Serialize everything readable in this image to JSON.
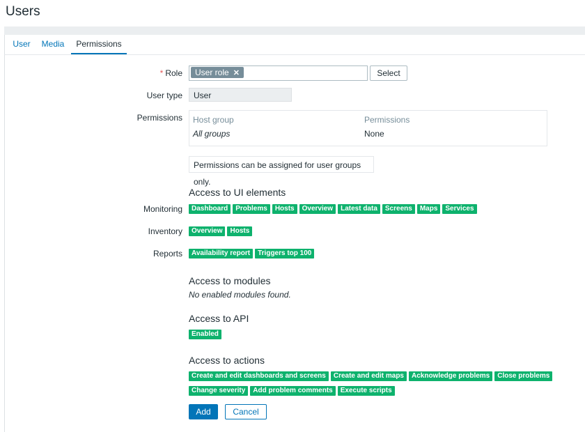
{
  "page_title": "Users",
  "tabs": [
    {
      "label": "User"
    },
    {
      "label": "Media"
    },
    {
      "label": "Permissions"
    }
  ],
  "form": {
    "role": {
      "label": "Role",
      "required_mark": "*",
      "value": "User role",
      "select_label": "Select"
    },
    "user_type": {
      "label": "User type",
      "value": "User"
    },
    "permissions": {
      "label": "Permissions",
      "headers": [
        "Host group",
        "Permissions"
      ],
      "rows": [
        [
          "All groups",
          "None"
        ]
      ],
      "note": "Permissions can be assigned for user groups only."
    }
  },
  "ui_access": {
    "title": "Access to UI elements",
    "groups": [
      {
        "label": "Monitoring",
        "items": [
          "Dashboard",
          "Problems",
          "Hosts",
          "Overview",
          "Latest data",
          "Screens",
          "Maps",
          "Services"
        ]
      },
      {
        "label": "Inventory",
        "items": [
          "Overview",
          "Hosts"
        ]
      },
      {
        "label": "Reports",
        "items": [
          "Availability report",
          "Triggers top 100"
        ]
      }
    ]
  },
  "modules": {
    "title": "Access to modules",
    "empty": "No enabled modules found."
  },
  "api": {
    "title": "Access to API",
    "status": "Enabled"
  },
  "actions": {
    "title": "Access to actions",
    "row1": [
      "Create and edit dashboards and screens",
      "Create and edit maps",
      "Acknowledge problems",
      "Close problems"
    ],
    "row2": [
      "Change severity",
      "Add problem comments",
      "Execute scripts"
    ]
  },
  "buttons": {
    "add": "Add",
    "cancel": "Cancel"
  },
  "colors": {
    "accent": "#0275b8",
    "badge_green": "#0eb26d",
    "chip_gray": "#768d99"
  }
}
